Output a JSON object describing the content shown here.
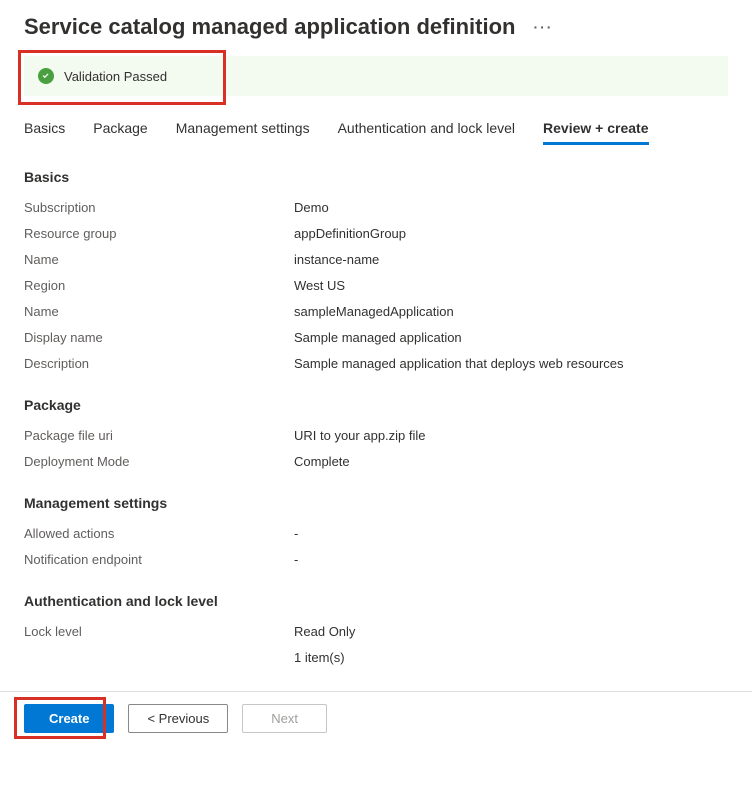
{
  "header": {
    "title": "Service catalog managed application definition",
    "more_icon": "···"
  },
  "validation": {
    "text": "Validation Passed"
  },
  "tabs": [
    {
      "label": "Basics",
      "active": false
    },
    {
      "label": "Package",
      "active": false
    },
    {
      "label": "Management settings",
      "active": false
    },
    {
      "label": "Authentication and lock level",
      "active": false
    },
    {
      "label": "Review + create",
      "active": true
    }
  ],
  "sections": {
    "basics": {
      "title": "Basics",
      "rows": [
        {
          "label": "Subscription",
          "value": "Demo"
        },
        {
          "label": "Resource group",
          "value": "appDefinitionGroup"
        },
        {
          "label": "Name",
          "value": "instance-name"
        },
        {
          "label": "Region",
          "value": "West US"
        },
        {
          "label": "Name",
          "value": "sampleManagedApplication"
        },
        {
          "label": "Display name",
          "value": "Sample managed application"
        },
        {
          "label": "Description",
          "value": "Sample managed application that deploys web resources"
        }
      ]
    },
    "package": {
      "title": "Package",
      "rows": [
        {
          "label": "Package file uri",
          "value": "URI to your app.zip file"
        },
        {
          "label": "Deployment Mode",
          "value": "Complete"
        }
      ]
    },
    "management": {
      "title": "Management settings",
      "rows": [
        {
          "label": "Allowed actions",
          "value": "-"
        },
        {
          "label": "Notification endpoint",
          "value": "-"
        }
      ]
    },
    "auth": {
      "title": "Authentication and lock level",
      "rows": [
        {
          "label": "Lock level",
          "value": "Read Only"
        },
        {
          "label": "",
          "value": "1 item(s)"
        }
      ]
    }
  },
  "footer": {
    "create": "Create",
    "previous": "< Previous",
    "next": "Next"
  }
}
